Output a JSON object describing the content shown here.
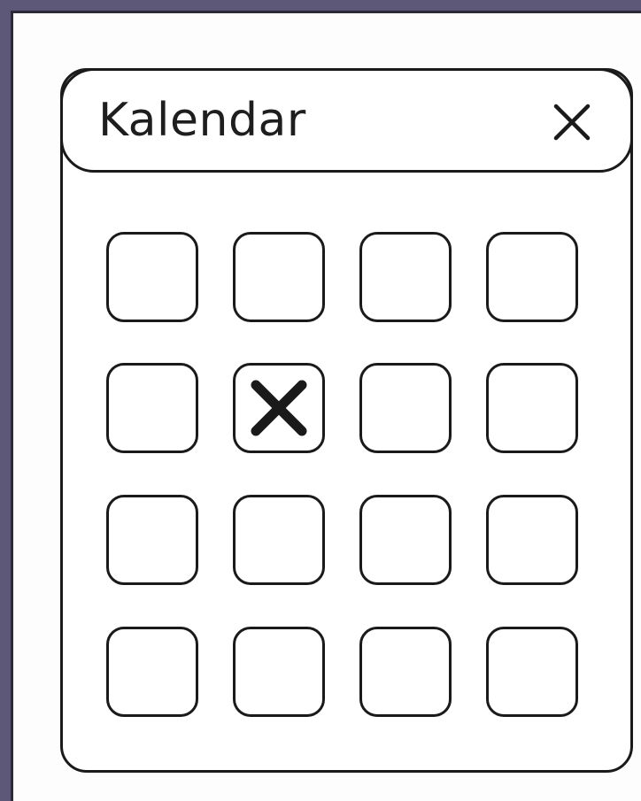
{
  "window": {
    "title": "Kalendar",
    "close_icon": "close-icon"
  },
  "grid": {
    "rows": 4,
    "columns": 4,
    "marked_cell": {
      "row": 2,
      "column": 2
    },
    "mark_icon": "x-mark-icon"
  },
  "colors": {
    "background": "#5d5878",
    "screen": "#fdfdfd",
    "stroke": "#1a1a1a"
  }
}
